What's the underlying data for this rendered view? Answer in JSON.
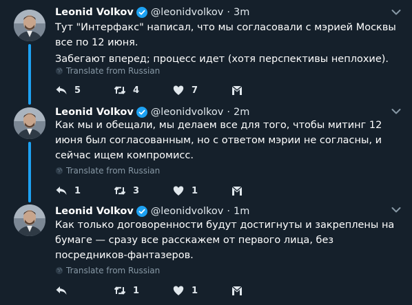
{
  "tweets": [
    {
      "name": "Leonid Volkov",
      "handle": "@leonidvolkov",
      "dot": "·",
      "time": "3m",
      "paragraphs": [
        "Тут \"Интерфакс\" написал, что мы согласовали с мэрией Москвы все по 12 июня.",
        "Забегают вперед; процесс идет (хотя перспективы неплохие)."
      ],
      "translate": "Translate from Russian",
      "replies": "5",
      "retweets": "4",
      "likes": "7"
    },
    {
      "name": "Leonid Volkov",
      "handle": "@leonidvolkov",
      "dot": "·",
      "time": "2m",
      "paragraphs": [
        "Как мы и обещали, мы делаем все для того, чтобы митинг 12 июня был согласованным, но с ответом мэрии не согласны, и сейчас ищем компромисс."
      ],
      "translate": "Translate from Russian",
      "replies": "1",
      "retweets": "3",
      "likes": "1"
    },
    {
      "name": "Leonid Volkov",
      "handle": "@leonidvolkov",
      "dot": "·",
      "time": "1m",
      "paragraphs": [
        "Как только договоренности будут достигнуты и закреплены на бумаге — сразу все расскажем от первого лица, без посредников-фантазеров."
      ],
      "translate": "Translate from Russian",
      "replies": "",
      "retweets": "1",
      "likes": "1"
    }
  ],
  "icons": {
    "verified": "verified-badge-icon",
    "caret": "chevron-down-icon",
    "globe": "globe-icon",
    "reply": "reply-icon",
    "retweet": "retweet-icon",
    "like": "heart-icon",
    "dm": "envelope-icon"
  },
  "colors": {
    "background": "#15202b",
    "thread_line": "#1da1f2",
    "verified": "#1da1f2",
    "muted": "#8899a6"
  }
}
